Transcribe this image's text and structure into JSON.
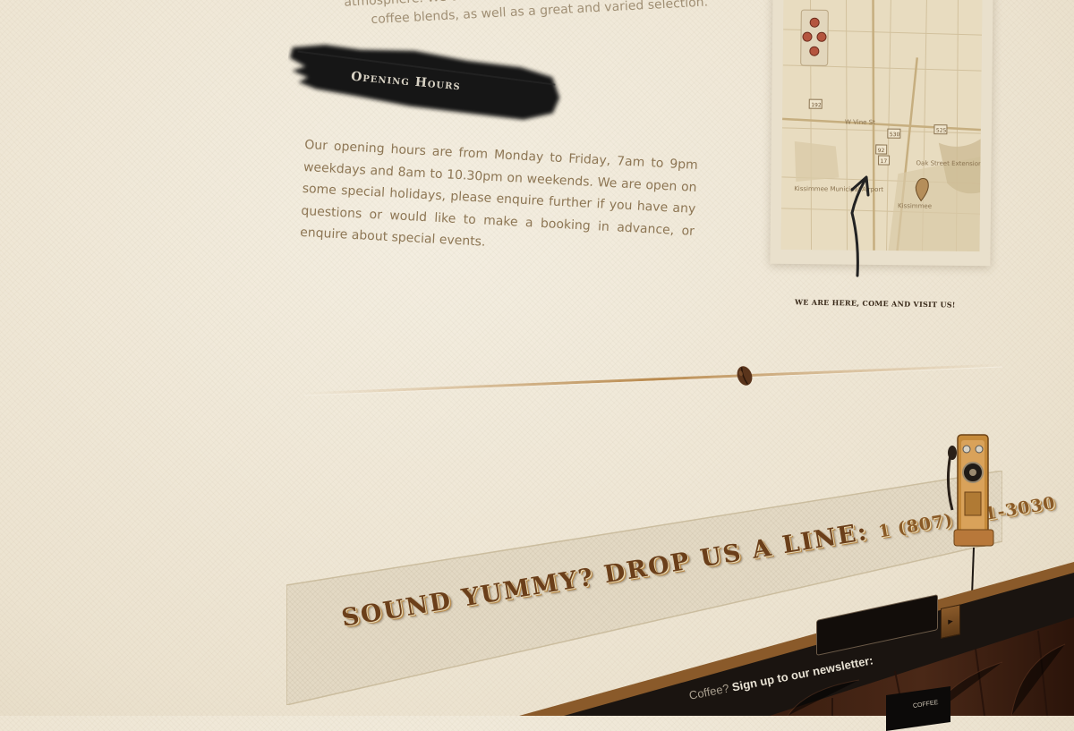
{
  "intro": {
    "line1": "atmosphere. We offer a wide variety of coffee shop with a",
    "line2": "coffee blends, as well as a great and varied selection."
  },
  "opening_hours": {
    "heading": "Opening Hours",
    "body": "Our opening hours are from Monday to Friday, 7am to 9pm weekdays and 8am to 10.30pm on weekends. We are open on some special holidays, please enquire further if you have any questions or would like to make a booking in advance, or enquire about special events."
  },
  "map": {
    "caption": "WE ARE HERE, COME AND VISIT US!",
    "labels": {
      "airport": "Kissimmee Municipal Airport",
      "city": "Kissimmee",
      "preserve": "Oak Street Extension & Preserve",
      "street": "W Vine St",
      "hwy192": "192",
      "hwy530": "530",
      "hwy525": "525",
      "hwy17": "17",
      "hwy92": "92"
    }
  },
  "contact": {
    "callout": "SOUND YUMMY? DROP US A LINE:",
    "phone": "1 (807) 951-3030"
  },
  "footer": {
    "newsletter_prefix": "Coffee?",
    "newsletter_label": "Sign up to our newsletter:",
    "button_glyph": "▸",
    "card_text": "COFFEE"
  },
  "colors": {
    "paper": "#efe7d6",
    "body_text": "#8d7654",
    "heading_brush": "#111111",
    "callout_brown": "#6b3f1a",
    "wood_dark": "#3a1d10",
    "footer_bar": "#1a1410"
  }
}
